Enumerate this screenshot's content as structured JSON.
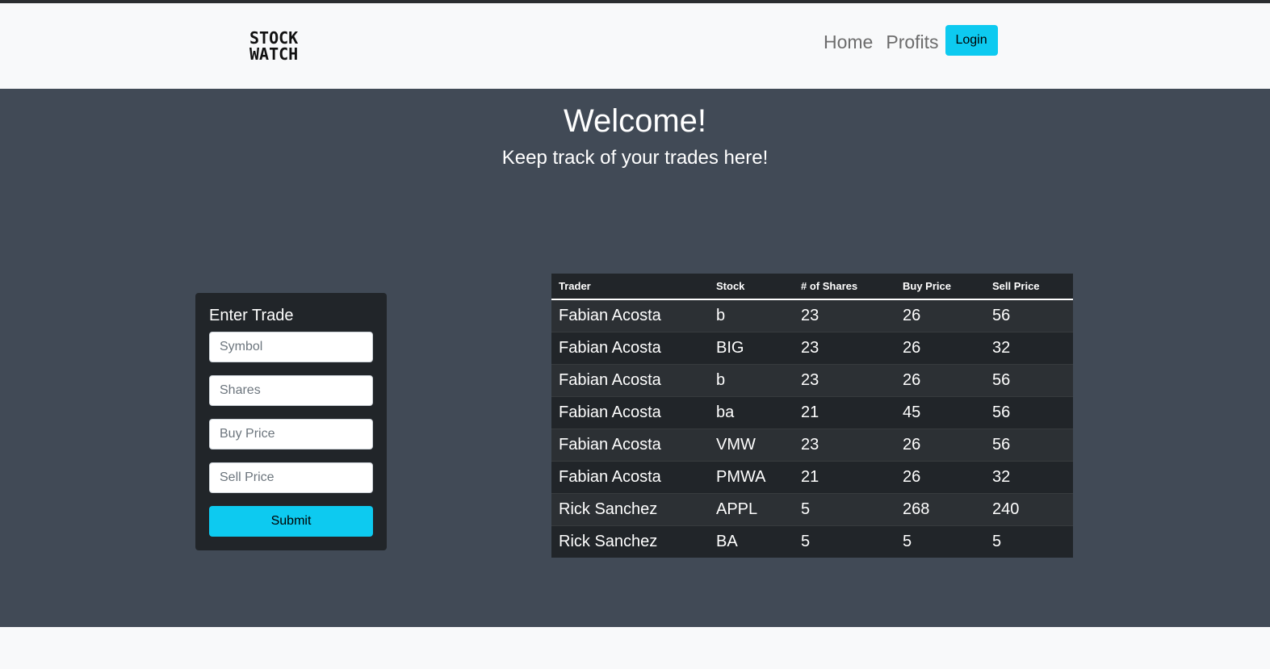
{
  "navbar": {
    "brand_line1": "STOCK",
    "brand_line2": "WATCH",
    "links": [
      "Home",
      "Profits"
    ],
    "login_label": "Login"
  },
  "hero": {
    "title": "Welcome!",
    "subtitle": "Keep track of your trades here!"
  },
  "trade_form": {
    "title": "Enter Trade",
    "symbol_placeholder": "Symbol",
    "shares_placeholder": "Shares",
    "buy_price_placeholder": "Buy Price",
    "sell_price_placeholder": "Sell Price",
    "submit_label": "Submit"
  },
  "table": {
    "headers": [
      "Trader",
      "Stock",
      "# of Shares",
      "Buy Price",
      "Sell Price"
    ],
    "rows": [
      [
        "Fabian Acosta",
        "b",
        "23",
        "26",
        "56"
      ],
      [
        "Fabian Acosta",
        "BIG",
        "23",
        "26",
        "32"
      ],
      [
        "Fabian Acosta",
        "b",
        "23",
        "26",
        "56"
      ],
      [
        "Fabian Acosta",
        "ba",
        "21",
        "45",
        "56"
      ],
      [
        "Fabian Acosta",
        "VMW",
        "23",
        "26",
        "56"
      ],
      [
        "Fabian Acosta",
        "PMWA",
        "21",
        "26",
        "32"
      ],
      [
        "Rick Sanchez",
        "APPL",
        "5",
        "268",
        "240"
      ],
      [
        "Rick Sanchez",
        "BA",
        "5",
        "5",
        "5"
      ]
    ]
  },
  "colors": {
    "accent": "#0dcaf0",
    "main_bg": "#414a56",
    "card_bg": "#212529"
  }
}
